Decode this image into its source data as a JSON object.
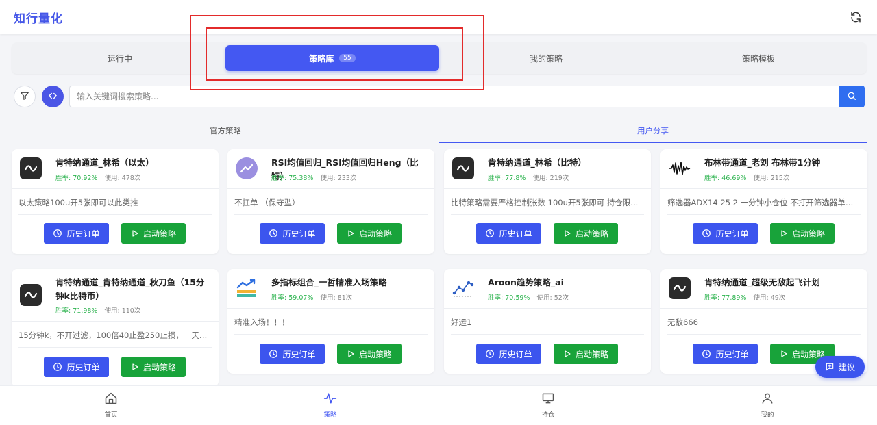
{
  "app": {
    "title": "知行量化",
    "refresh_icon": "refresh-icon"
  },
  "tabs": [
    {
      "label": "运行中",
      "active": false
    },
    {
      "label": "策略库",
      "active": true,
      "badge": "55"
    },
    {
      "label": "我的策略",
      "active": false
    },
    {
      "label": "策略模板",
      "active": false
    }
  ],
  "search": {
    "placeholder": "输入关键词搜索策略...",
    "value": ""
  },
  "subtabs": [
    {
      "label": "官方策略",
      "active": false
    },
    {
      "label": "用户分享",
      "active": true
    }
  ],
  "labels": {
    "win_rate": "胜率:",
    "usage": "使用:",
    "history": "历史订单",
    "start": "启动策略"
  },
  "strategies": [
    {
      "title": "肯特纳通道_林希（以太）",
      "win_rate": "70.92%",
      "usage": "478次",
      "desc": "以太策略100u开5张即可以此类推",
      "icon": "wave-icon"
    },
    {
      "title": "RSI均值回归_RSI均值回归Heng（比特）",
      "win_rate": "75.38%",
      "usage": "233次",
      "desc": "不扛单 （保守型）",
      "icon": "trend-circle-icon"
    },
    {
      "title": "肯特纳通道_林希（比特）",
      "win_rate": "77.8%",
      "usage": "219次",
      "desc": "比特策略需要严格控制张数 100u开5张即可 持仓限...",
      "icon": "wave-icon"
    },
    {
      "title": "布林带通道_老刘 布林带1分钟",
      "win_rate": "46.69%",
      "usage": "215次",
      "desc": "筛选器ADX14 25 2 一分钟小仓位 不打开筛选器单子...",
      "icon": "soundwave-icon"
    },
    {
      "title": "肯特纳通道_肯特纳通道_秋刀鱼（15分钟k比特币）",
      "win_rate": "71.98%",
      "usage": "110次",
      "desc": "15分钟k，不开过滤，100倍40止盈250止损，一天就...",
      "icon": "wave-icon"
    },
    {
      "title": "多指标组合_一哲精准入场策略",
      "win_rate": "59.07%",
      "usage": "81次",
      "desc": "精准入场！！！",
      "icon": "bars-trend-icon"
    },
    {
      "title": "Aroon趋势策略_ai",
      "win_rate": "70.59%",
      "usage": "52次",
      "desc": "好运1",
      "icon": "scatter-trend-icon"
    },
    {
      "title": "肯特纳通道_超级无敌起飞计划",
      "win_rate": "77.89%",
      "usage": "49次",
      "desc": "无敌666",
      "icon": "wave-icon"
    }
  ],
  "suggest": {
    "label": "建议"
  },
  "nav": [
    {
      "label": "首页",
      "icon": "home-icon",
      "active": false
    },
    {
      "label": "策略",
      "icon": "pulse-icon",
      "active": true
    },
    {
      "label": "持仓",
      "icon": "monitor-icon",
      "active": false
    },
    {
      "label": "我的",
      "icon": "user-icon",
      "active": false
    }
  ],
  "colors": {
    "primary": "#4458f2",
    "success": "#18a33a",
    "win_rate": "#2db34f",
    "highlight_box": "#e32b2b"
  }
}
